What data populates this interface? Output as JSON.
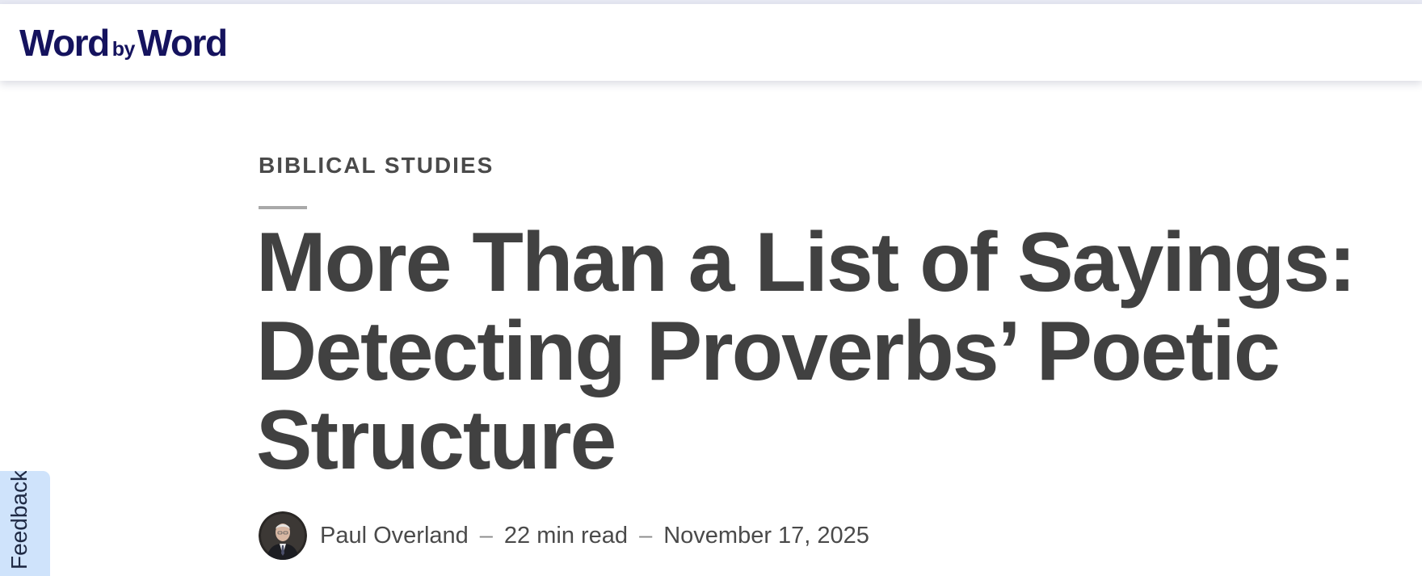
{
  "header": {
    "logo": {
      "word_left": "Word",
      "by": "by",
      "word_right": "Word"
    },
    "brand_color": "#15135e",
    "accent_bar_color": "#e7e9f3"
  },
  "article": {
    "category": "BIBLICAL STUDIES",
    "title": "More Than a List of Sayings: Detecting Proverbs’ Poetic Structure",
    "byline": {
      "author": "Paul Overland",
      "separator": "–",
      "read_time": "22 min read",
      "date": "November 17, 2025",
      "avatar_icon": "author-photo-icon"
    },
    "text_color": "#414141"
  },
  "feedback": {
    "label": "Feedback",
    "background_color": "#cfe3fb"
  }
}
